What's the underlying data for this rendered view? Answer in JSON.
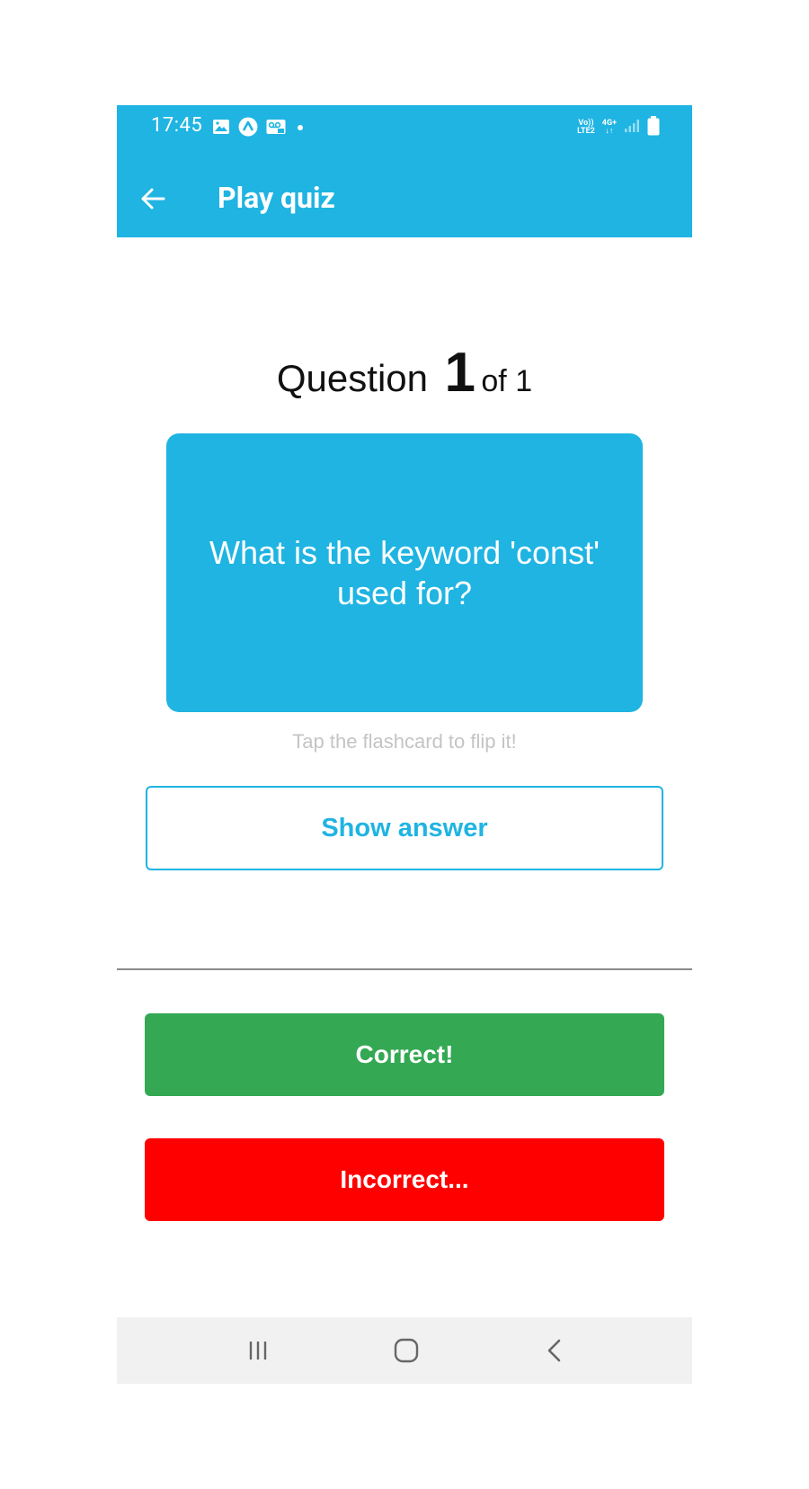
{
  "status_bar": {
    "time": "17:45",
    "left_icons": [
      "image-icon",
      "app-icon",
      "voicemail-icon",
      "dot-icon"
    ],
    "volte_label": "Vo))",
    "lte_label": "LTE2",
    "network_label": "4G+"
  },
  "app_bar": {
    "title": "Play quiz",
    "back_icon": "arrow-left-icon",
    "background_color": "#1fb4e2"
  },
  "quiz": {
    "question_word": "Question",
    "current_number": "1",
    "of_total": "of 1",
    "flashcard_text": "What is the keyword 'const' used for?",
    "hint": "Tap the flashcard to flip it!",
    "show_answer_label": "Show answer"
  },
  "actions": {
    "correct_label": "Correct!",
    "incorrect_label": "Incorrect...",
    "correct_color": "#34a853",
    "incorrect_color": "#fe0000"
  },
  "nav_bar": {
    "items": [
      "recents-icon",
      "home-icon",
      "back-icon"
    ]
  }
}
